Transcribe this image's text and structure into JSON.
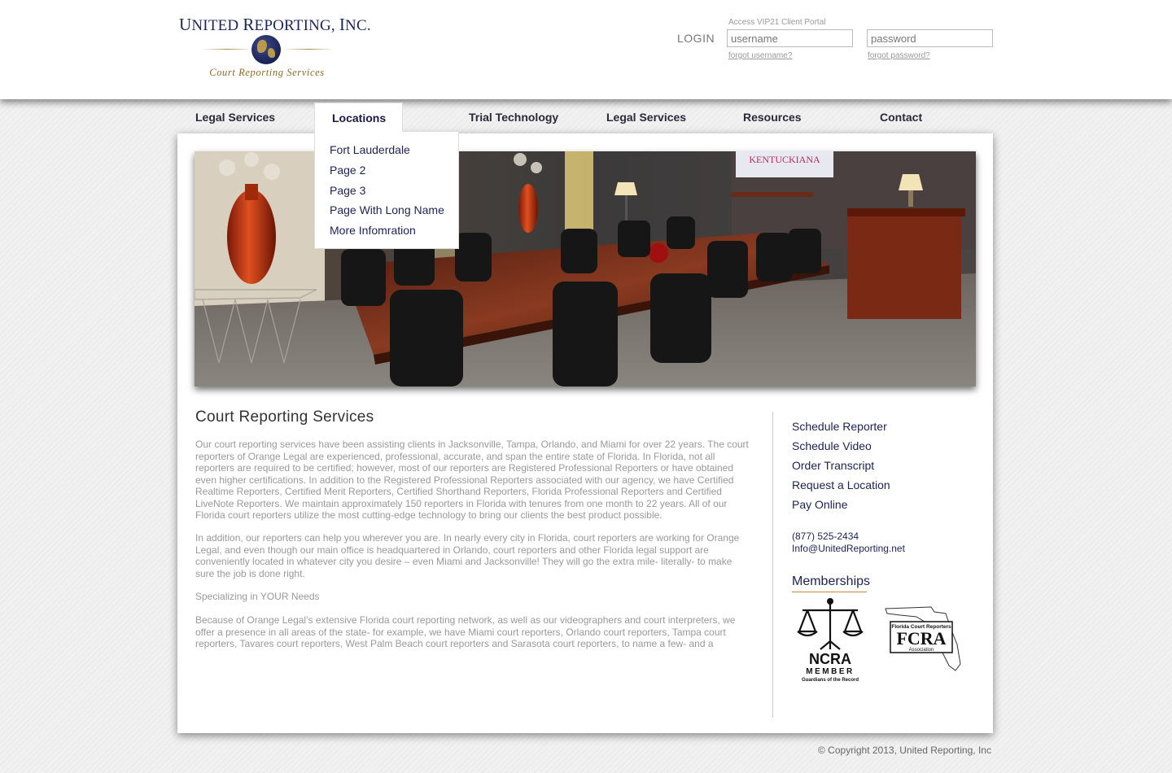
{
  "logo": {
    "name_first": "U",
    "name_rest": "NITED ",
    "name_r": "R",
    "name_rest2": "EPORTING, ",
    "name_i": "I",
    "name_rest3": "NC.",
    "tagline": "Court Reporting Services"
  },
  "login": {
    "label": "LOGIN",
    "portal_label": "Access VIP21 Client Portal",
    "username_placeholder": "username",
    "password_placeholder": "password",
    "forgot_username": "forgot username?",
    "forgot_password": "forgot password?"
  },
  "nav": {
    "items": [
      "Legal Services",
      "Locations",
      "Trial Technology",
      "Legal Services",
      "Resources",
      "Contact"
    ],
    "dropdown": [
      "Fort Lauderdale",
      "Page 2",
      "Page 3",
      "Page With Long Name",
      "More Infomration"
    ]
  },
  "banner": {
    "sign_text": "KENTUCKIANA"
  },
  "content": {
    "title": "Court Reporting Services",
    "paragraphs": [
      "Our court reporting services have been assisting clients in Jacksonville, Tampa, Orlando, and Miami for over 22 years. The court reporters of Orange Legal are experienced, professional, accurate, and span the entire state of Florida. In Florida, not all reporters are required to be certified; however, most of our reporters are Registered Professional Reporters or have obtained even higher certifications. In addition to the Registered Professional Reporters associated with our agency, we have Certified Realtime Reporters, Certified Merit Reporters, Certified Shorthand Reporters, Florida Professional Reporters and Certified LiveNote Reporters. We maintain approximately 150 reporters in Florida with tenures from one month to 22 years. All of our Florida court reporters utilize the most cutting-edge technology to bring our clients the best product possible.",
      "In addition, our reporters can help you wherever you are. In nearly every city in Florida, court reporters are working for Orange Legal, and even though our main office is headquartered in Orlando, court reporters and other Florida legal support are conveniently located in whatever city you desire – even Miami and Jacksonville! They will go the extra mile- literally- to make sure the job is done right.",
      "Specializing in YOUR Needs",
      "Because of Orange Legal’s extensive Florida court reporting network, as well as our videographers and court interpreters, we offer a presence in all areas of the state- for example, we have Miami court reporters, Orlando court reporters, Tampa court reporters, Tavares court reporters, West Palm Beach court reporters and Sarasota court reporters, to name a few- and a"
    ]
  },
  "sidebar": {
    "links": [
      "Schedule Reporter",
      "Schedule Video",
      "Order Transcript",
      "Request a Location",
      "Pay Online"
    ],
    "phone": "(877) 525-2434",
    "email": "Info@UnitedReporting.net",
    "memberships_title": "Memberships",
    "ncra": {
      "name": "NCRA",
      "member": "MEMBER",
      "sub": "Guardians of the Record"
    },
    "fcra": {
      "top": "Florida Court Reporters",
      "name": "FCRA",
      "bottom": "Association"
    }
  },
  "footer": {
    "copyright": "© Copyright 2013, United Reporting, Inc"
  },
  "colors": {
    "navy": "#1c2350",
    "gold": "#a88a4a"
  }
}
